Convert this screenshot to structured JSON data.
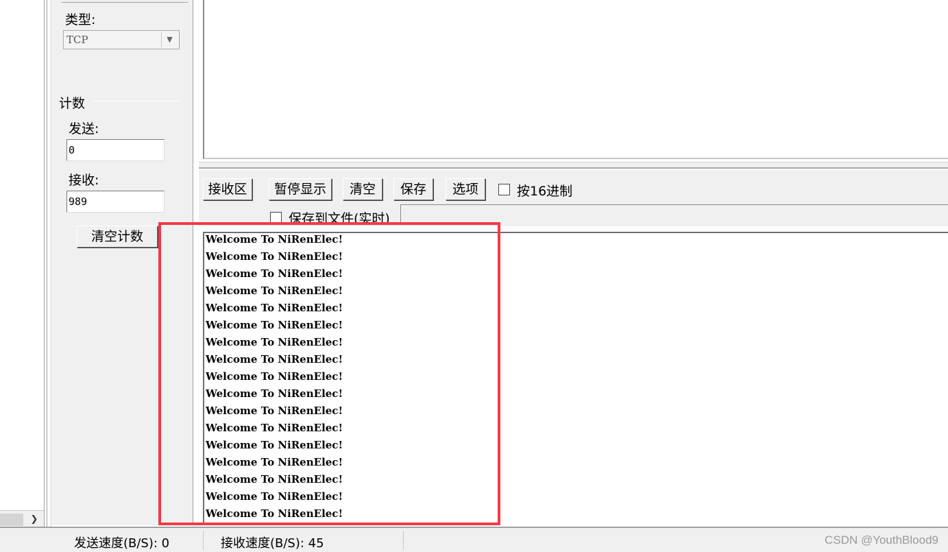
{
  "settings": {
    "type_label": "类型:",
    "type_value": "TCP",
    "count_group_label": "计数",
    "send_label": "发送:",
    "send_count": "0",
    "recv_label": "接收:",
    "recv_count": "989",
    "clear_count_button": "清空计数"
  },
  "toolbar": {
    "recv_zone_button": "接收区",
    "pause_display_button": "暂停显示",
    "clear_button": "清空",
    "save_button": "保存",
    "options_button": "选项",
    "hex_checkbox_label": "按16进制",
    "save_to_file_label": "保存到文件(实时)"
  },
  "receive": {
    "lines": [
      "Welcome To NiRenElec!",
      "Welcome To NiRenElec!",
      "Welcome To NiRenElec!",
      "Welcome To NiRenElec!",
      "Welcome To NiRenElec!",
      "Welcome To NiRenElec!",
      "Welcome To NiRenElec!",
      "Welcome To NiRenElec!",
      "Welcome To NiRenElec!",
      "Welcome To NiRenElec!",
      "Welcome To NiRenElec!",
      "Welcome To NiRenElec!",
      "Welcome To NiRenElec!",
      "Welcome To NiRenElec!",
      "Welcome To NiRenElec!",
      "Welcome To NiRenElec!",
      "Welcome To NiRenElec!"
    ]
  },
  "statusbar": {
    "send_speed": "发送速度(B/S): 0",
    "recv_speed": "接收速度(B/S): 45",
    "watermark": "CSDN @YouthBlood9"
  },
  "colors": {
    "highlight": "#f43a45",
    "window_bg": "#f0f0f0"
  }
}
